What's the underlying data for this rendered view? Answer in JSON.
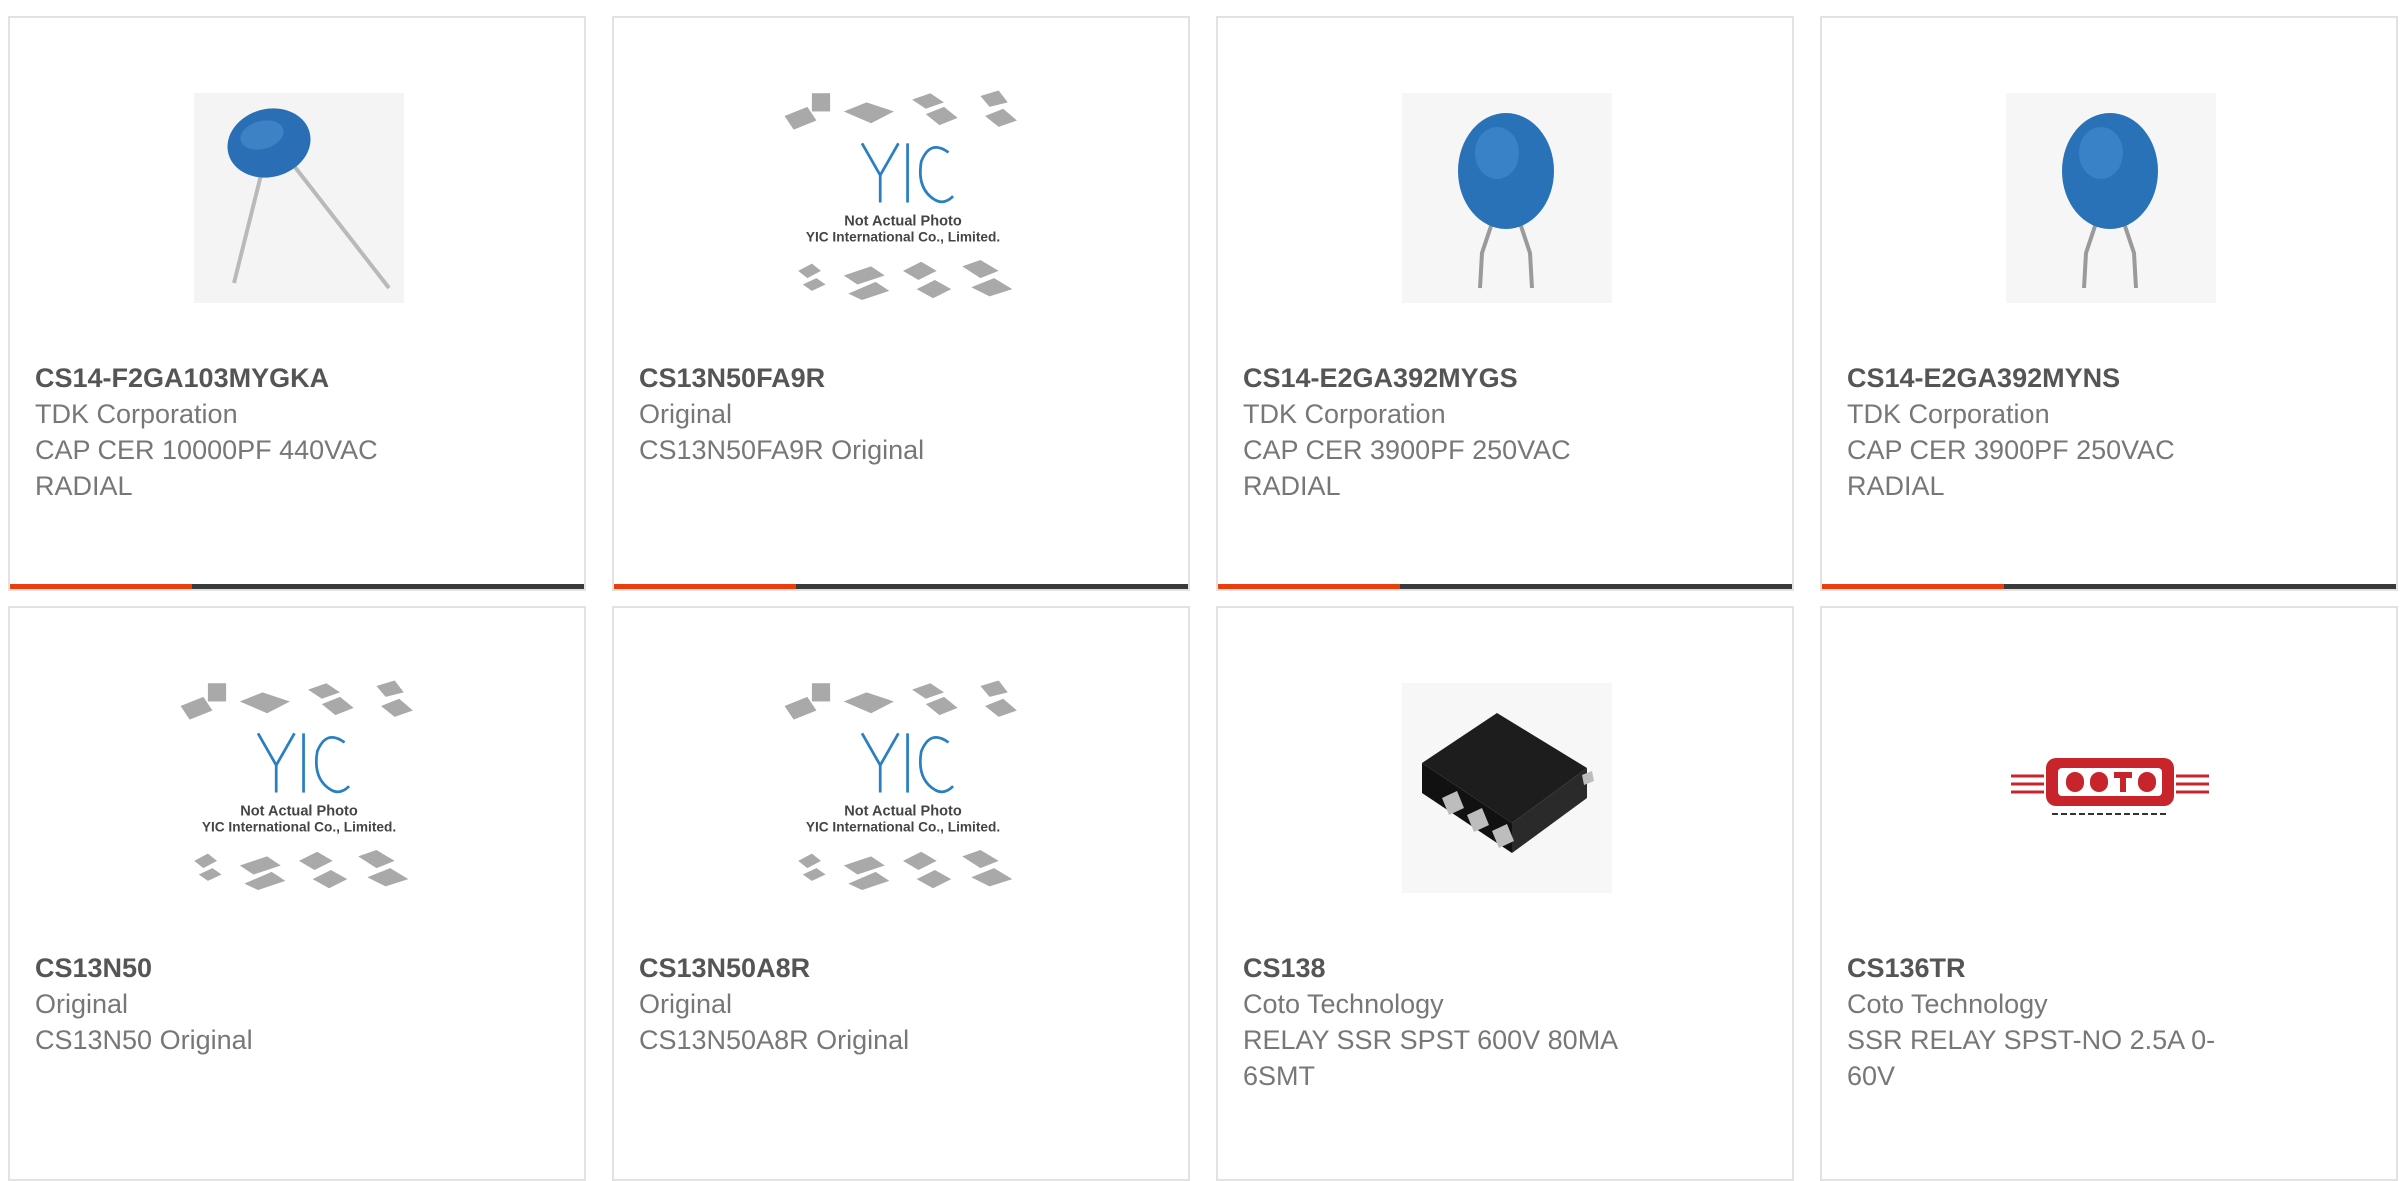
{
  "products": [
    {
      "part_number": "CS14-F2GA103MYGKA",
      "manufacturer": "TDK Corporation",
      "description": "CAP CER 10000PF 440VAC RADIAL",
      "image_icon": "disc-capacitor-tilted-icon"
    },
    {
      "part_number": "CS13N50FA9R",
      "manufacturer": "Original",
      "description": "CS13N50FA9R Original",
      "image_icon": "yic-placeholder-icon",
      "placeholder_caption_1": "Not Actual Photo",
      "placeholder_caption_2": "YIC International Co., Limited."
    },
    {
      "part_number": "CS14-E2GA392MYGS",
      "manufacturer": "TDK Corporation",
      "description": "CAP CER 3900PF 250VAC RADIAL",
      "image_icon": "disc-capacitor-icon"
    },
    {
      "part_number": "CS14-E2GA392MYNS",
      "manufacturer": "TDK Corporation",
      "description": "CAP CER 3900PF 250VAC RADIAL",
      "image_icon": "disc-capacitor-icon"
    },
    {
      "part_number": "CS13N50",
      "manufacturer": "Original",
      "description": "CS13N50 Original",
      "image_icon": "yic-placeholder-icon",
      "placeholder_caption_1": "Not Actual Photo",
      "placeholder_caption_2": "YIC International Co., Limited."
    },
    {
      "part_number": "CS13N50A8R",
      "manufacturer": "Original",
      "description": "CS13N50A8R Original",
      "image_icon": "yic-placeholder-icon",
      "placeholder_caption_1": "Not Actual Photo",
      "placeholder_caption_2": "YIC International Co., Limited."
    },
    {
      "part_number": "CS138",
      "manufacturer": "Coto Technology",
      "description": "RELAY SSR SPST 600V 80MA 6SMT",
      "image_icon": "smt-relay-chip-icon"
    },
    {
      "part_number": "CS136TR",
      "manufacturer": "Coto Technology",
      "description": "SSR RELAY SPST-NO 2.5A 0-60V",
      "image_icon": "coto-technology-logo-icon"
    }
  ],
  "colors": {
    "accent": "#e8400c",
    "bar": "#3a3a3a",
    "capacitor_blue": "#2a72b8",
    "coto_red": "#c8242b"
  }
}
